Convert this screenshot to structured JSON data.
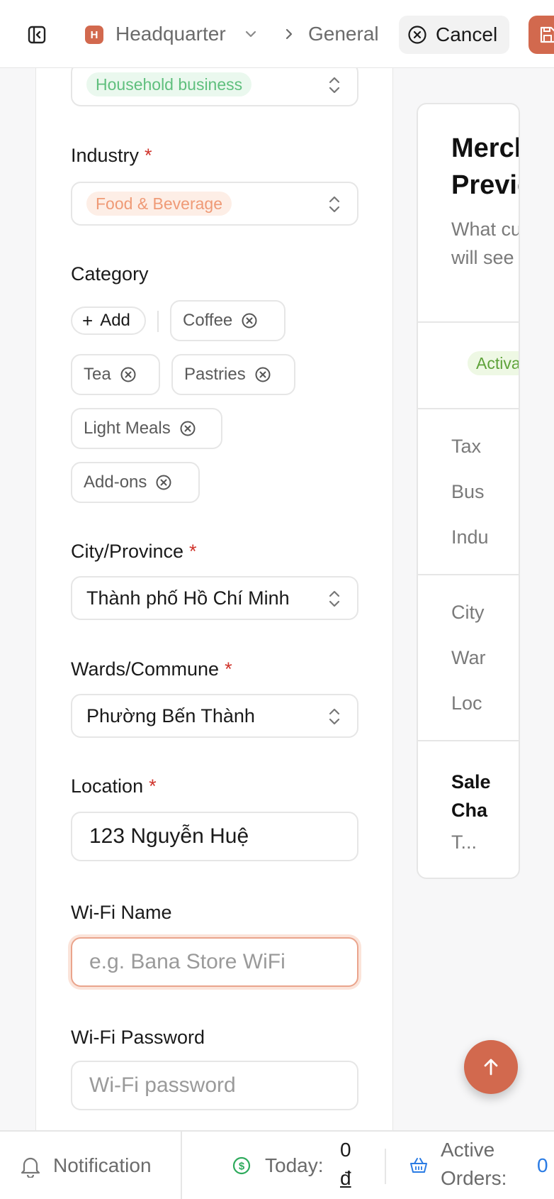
{
  "header": {
    "org_initial": "H",
    "org_name": "Headquarter",
    "breadcrumb": "General",
    "cancel_label": "Cancel",
    "accent_color": "#d2694e"
  },
  "form": {
    "business_type_value": "Household business",
    "industry_label": "Industry",
    "industry_value": "Food & Beverage",
    "required_mark": "*",
    "category_label": "Category",
    "add_label": "Add",
    "categories": [
      "Coffee",
      "Tea",
      "Pastries",
      "Light Meals",
      "Add-ons"
    ],
    "city_label": "City/Province",
    "city_value": "Thành phố Hồ Chí Minh",
    "ward_label": "Wards/Commune",
    "ward_value": "Phường Bến Thành",
    "location_label": "Location",
    "location_value": "123 Nguyễn Huệ",
    "wifi_name_label": "Wi-Fi Name",
    "wifi_name_placeholder": "e.g. Bana Store WiFi",
    "wifi_password_label": "Wi-Fi Password",
    "wifi_password_placeholder": "Wi-Fi password"
  },
  "preview": {
    "title_line1": "Merchant",
    "title_line2": "Preview",
    "subtitle": "What customers will see",
    "status": "Activated",
    "rows_a": [
      "Tax",
      "Bus",
      "Indu"
    ],
    "rows_b": [
      "City",
      "War",
      "Loc"
    ],
    "section_line1": "Sale",
    "section_line2": "Cha",
    "truncated": "T..."
  },
  "footer": {
    "notification_label": "Notification",
    "today_label": "Today:",
    "today_value": "0",
    "today_currency": "đ",
    "active_orders_label_1": "Active",
    "active_orders_label_2": "Orders:",
    "active_orders_value": "0"
  }
}
